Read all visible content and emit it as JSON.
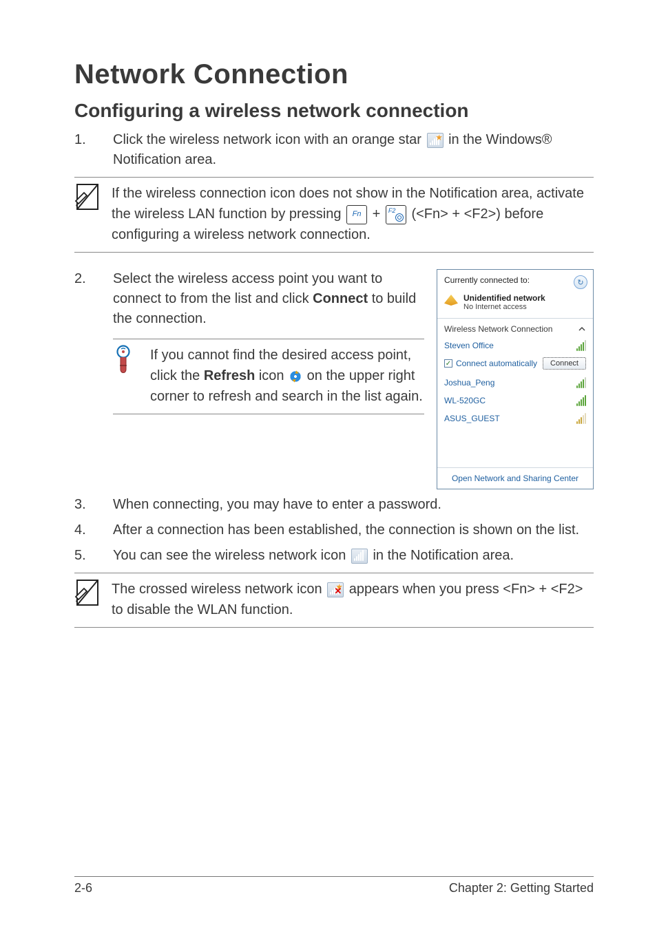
{
  "title": "Network Connection",
  "subtitle": "Configuring a wireless network connection",
  "steps": {
    "s1_pre": "Click the wireless network icon with an orange star ",
    "s1_post": " in the Windows® Notification area."
  },
  "note1": {
    "line1": "If the wireless connection icon does not show in the Notification area, activate the wireless LAN function by pressing ",
    "plus": " + ",
    "line2": " (<Fn> + <F2>) before configuring a wireless network connection.",
    "key1": "Fn",
    "key2": "F2"
  },
  "step2": {
    "num": "2.",
    "text_a": "Select the wireless access point you want to connect to from the list and click ",
    "bold": "Connect",
    "text_b": " to build the connection."
  },
  "tip": {
    "a": "If you cannot find the desired access point, click the ",
    "bold": "Refresh",
    "b": " icon ",
    "c": " on the upper right corner to refresh and search in the list again."
  },
  "popup": {
    "hdr": "Currently connected to:",
    "net_name": "Unidentified network",
    "net_sub": "No Internet access",
    "section": "Wireless Network Connection",
    "aps": [
      "Steven Office",
      "Joshua_Peng",
      "WL-520GC",
      "ASUS_GUEST"
    ],
    "auto_label": "Connect automatically",
    "connect": "Connect",
    "footer": "Open Network and Sharing Center"
  },
  "step3": {
    "num": "3.",
    "text": "When connecting, you may have to enter a password."
  },
  "step4": {
    "num": "4.",
    "text": "After a connection has been established, the connection is shown on the list."
  },
  "step5": {
    "num": "5.",
    "a": "You can see the wireless network icon ",
    "b": " in the Notification area."
  },
  "note2": {
    "a": "The crossed wireless network icon ",
    "b": " appears when you press <Fn> + <F2> to disable the WLAN function."
  },
  "footer": {
    "page": "2-6",
    "chapter": "Chapter 2: Getting Started"
  },
  "step_nums": {
    "s1": "1.",
    "s2": "2.",
    "s3": "3.",
    "s4": "4.",
    "s5": "5."
  }
}
